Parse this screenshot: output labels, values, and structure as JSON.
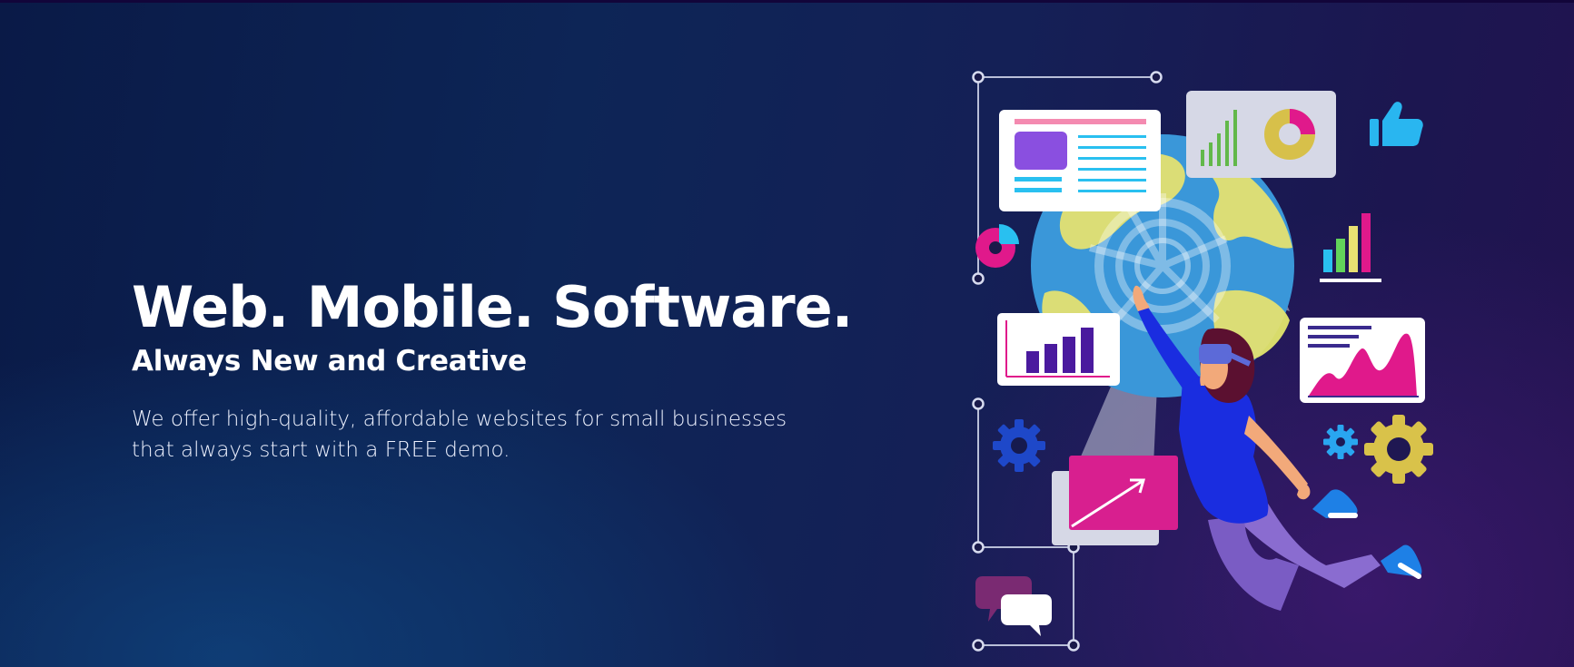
{
  "hero": {
    "headline": "Web. Mobile. Software.",
    "subheadline": "Always New and Creative",
    "description": "We offer high-quality, affordable websites for small businesses that always start with a FREE demo."
  },
  "illustration": {
    "subject": "person-with-vr-headset-touching-globe",
    "icons": [
      "thumbs-up-icon",
      "pie-chart-icon",
      "bar-chart-icon",
      "gear-icon",
      "chat-bubbles-icon",
      "trend-arrow-icon",
      "area-chart-icon",
      "webpage-layout-icon"
    ]
  },
  "colors": {
    "background_start": "#0a1a47",
    "background_end": "#22134f",
    "text": "#ffffff",
    "accent_pink": "#e8198b",
    "accent_cyan": "#29c0f0",
    "accent_yellow": "#e9e072",
    "accent_blue": "#1e3fd4",
    "accent_purple": "#8a4fe0"
  }
}
